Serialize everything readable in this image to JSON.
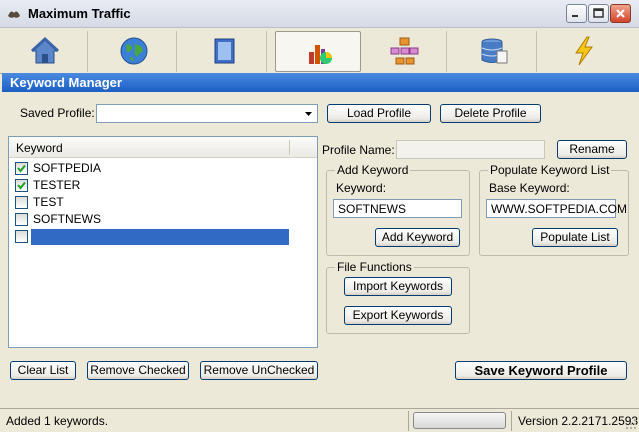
{
  "window": {
    "title": "Maximum Traffic"
  },
  "toolbar": {
    "tools": [
      {
        "icon": "home-icon"
      },
      {
        "icon": "globe-icon"
      },
      {
        "icon": "document-icon"
      },
      {
        "icon": "chart-icon"
      },
      {
        "icon": "sitemap-icon"
      },
      {
        "icon": "database-icon"
      },
      {
        "icon": "lightning-icon"
      }
    ],
    "active_index": 3
  },
  "section": {
    "title": "Keyword Manager"
  },
  "profile": {
    "saved_profile_label": "Saved Profile:",
    "saved_profile_value": "",
    "load_label": "Load Profile",
    "delete_label": "Delete Profile",
    "name_label": "Profile Name:",
    "name_value": "",
    "rename_label": "Rename"
  },
  "keywords": {
    "column_header": "Keyword",
    "items": [
      {
        "text": "SOFTPEDIA",
        "checked": true
      },
      {
        "text": "TESTER",
        "checked": true
      },
      {
        "text": "TEST",
        "checked": false
      },
      {
        "text": "SOFTNEWS",
        "checked": false
      },
      {
        "text": "",
        "checked": false,
        "editing": true
      }
    ]
  },
  "add_keyword": {
    "group_title": "Add Keyword",
    "field_label": "Keyword:",
    "field_value": "SOFTNEWS",
    "button_label": "Add Keyword"
  },
  "populate": {
    "group_title": "Populate Keyword List",
    "field_label": "Base Keyword:",
    "field_value": "WWW.SOFTPEDIA.COM",
    "button_label": "Populate List"
  },
  "file_functions": {
    "group_title": "File Functions",
    "import_label": "Import Keywords",
    "export_label": "Export Keywords"
  },
  "actions": {
    "clear_label": "Clear List",
    "remove_checked_label": "Remove Checked",
    "remove_unchecked_label": "Remove UnChecked",
    "save_label": "Save Keyword Profile"
  },
  "status": {
    "message": "Added 1 keywords.",
    "version": "Version 2.2.2171.2593"
  },
  "colors": {
    "header_band": "#1b5fc6",
    "selection": "#316ac5"
  }
}
